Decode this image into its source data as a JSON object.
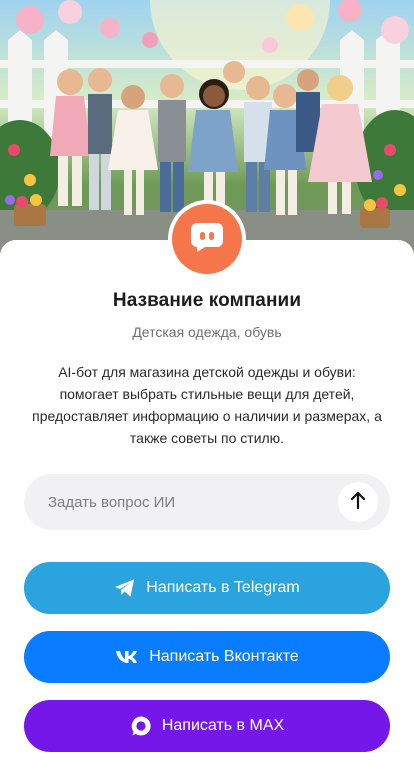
{
  "company": {
    "name": "Название компании",
    "subtitle": "Детская одежда, обувь",
    "description": "AI-бот для магазина детской одежды и обуви: помогает выбрать стильные вещи для детей, предоставляет информацию о наличии и размерах, а также советы по стилю."
  },
  "ask": {
    "placeholder": "Задать вопрос ИИ",
    "send_icon": "arrow-up-icon"
  },
  "buttons": {
    "telegram": {
      "label": "Написать в Telegram",
      "icon": "telegram-icon",
      "color": "#2ba3df"
    },
    "vk": {
      "label": "Написать Вконтакте",
      "icon": "vk-icon",
      "color": "#0a7cff"
    },
    "max": {
      "label": "Написать в MAX",
      "icon": "max-icon",
      "color": "#7417e8"
    }
  },
  "avatar": {
    "icon": "chat-bot-icon",
    "color": "#f5764a"
  }
}
